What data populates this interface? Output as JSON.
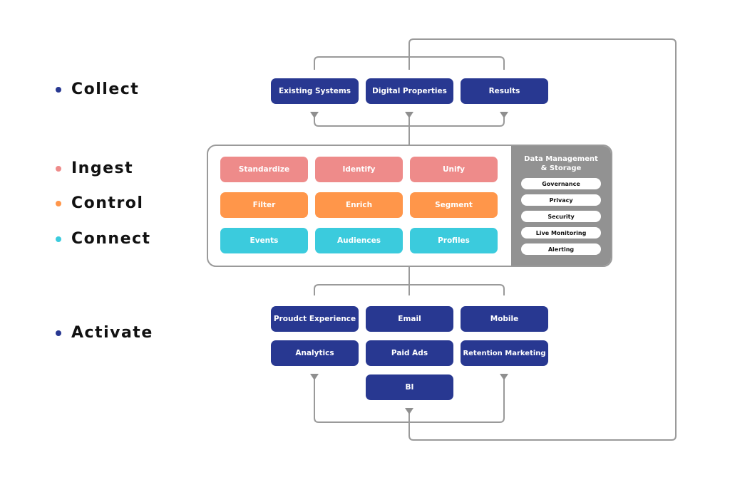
{
  "stages": [
    {
      "label": "Collect",
      "color": "#283891"
    },
    {
      "label": "Ingest",
      "color": "#ee8b8a"
    },
    {
      "label": "Control",
      "color": "#ff964a"
    },
    {
      "label": "Connect",
      "color": "#3bcbdd"
    },
    {
      "label": "Activate",
      "color": "#283891"
    }
  ],
  "collect": [
    "Existing Systems",
    "Digital Properties",
    "Results"
  ],
  "ingest": [
    "Standardize",
    "Identify",
    "Unify"
  ],
  "control": [
    "Filter",
    "Enrich",
    "Segment"
  ],
  "connect": [
    "Events",
    "Audiences",
    "Profiles"
  ],
  "data_management": {
    "title_line1": "Data Management",
    "title_line2": "& Storage",
    "items": [
      "Governance",
      "Privacy",
      "Security",
      "Live Monitoring",
      "Alerting"
    ]
  },
  "activate": [
    "Proudct Experience",
    "Email",
    "Mobile",
    "Analytics",
    "Paid Ads",
    "Retention Marketing",
    "BI"
  ],
  "colors": {
    "navy": "#283891",
    "pink": "#ee8b8a",
    "orange": "#ff964a",
    "cyan": "#3bcbdd",
    "connector": "#999999"
  }
}
